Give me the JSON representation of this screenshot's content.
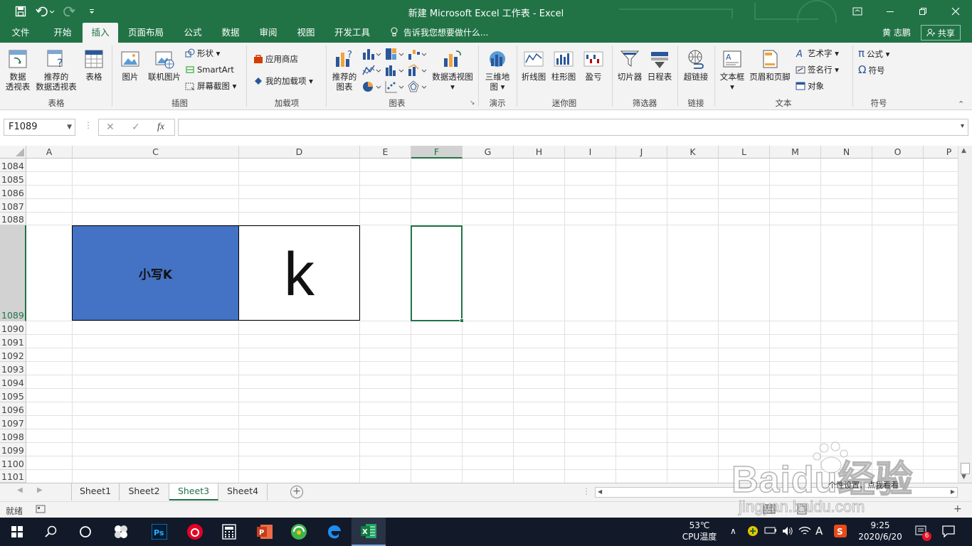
{
  "window": {
    "title": "新建 Microsoft Excel 工作表 - Excel",
    "accent_color": "#217346"
  },
  "quick_access": {
    "save_icon": "save-icon",
    "undo_icon": "undo-icon",
    "redo_icon": "redo-icon",
    "customize_icon": "customize-icon"
  },
  "tabs": [
    {
      "label": "文件"
    },
    {
      "label": "开始"
    },
    {
      "label": "插入",
      "active": true
    },
    {
      "label": "页面布局"
    },
    {
      "label": "公式"
    },
    {
      "label": "数据"
    },
    {
      "label": "审阅"
    },
    {
      "label": "视图"
    },
    {
      "label": "开发工具"
    }
  ],
  "tell_me": "告诉我您想要做什么...",
  "user": "黄 志鹏",
  "share": "共享",
  "ribbon": {
    "tables": {
      "group": "表格",
      "pivot_line1": "数据",
      "pivot_line2": "透视表",
      "rec_pivot_line1": "推荐的",
      "rec_pivot_line2": "数据透视表",
      "table": "表格"
    },
    "illustrations": {
      "group": "插图",
      "pictures": "图片",
      "online_pictures": "联机图片",
      "shapes": "形状",
      "smartart": "SmartArt",
      "screenshot": "屏幕截图"
    },
    "addins": {
      "group": "加载项",
      "store": "应用商店",
      "my_addins": "我的加载项"
    },
    "charts": {
      "group": "图表",
      "rec_line1": "推荐的",
      "rec_line2": "图表",
      "pivotchart": "数据透视图"
    },
    "tours": {
      "group": "演示",
      "map_line1": "三维地",
      "map_line2": "图"
    },
    "sparklines": {
      "group": "迷你图",
      "line": "折线图",
      "column": "柱形图",
      "winloss": "盈亏"
    },
    "filters": {
      "group": "筛选器",
      "slicer": "切片器",
      "timeline": "日程表"
    },
    "links": {
      "group": "链接",
      "hyperlink": "超链接"
    },
    "text": {
      "group": "文本",
      "textbox": "文本框",
      "header_footer": "页眉和页脚",
      "wordart": "艺术字",
      "signature": "签名行",
      "object": "对象"
    },
    "symbols": {
      "group": "符号",
      "equation": "公式",
      "symbol": "符号"
    }
  },
  "formula_bar": {
    "name_box": "F1089",
    "cancel": "✕",
    "enter": "✓",
    "fx": "fx",
    "content": ""
  },
  "columns": [
    "A",
    "C",
    "D",
    "E",
    "F",
    "G",
    "H",
    "I",
    "J",
    "K",
    "L",
    "M",
    "N",
    "O",
    "P"
  ],
  "selected_column": "F",
  "rows": [
    "1084",
    "1085",
    "1086",
    "1087",
    "1088",
    "1089",
    "1090",
    "1091",
    "1092",
    "1093",
    "1094",
    "1095",
    "1096",
    "1097",
    "1098",
    "1099",
    "1100",
    "1101"
  ],
  "selected_row": "1089",
  "cells": {
    "C1089": {
      "value": "小写K",
      "fill": "#4472c4"
    },
    "D1089": {
      "value": "k"
    }
  },
  "sheets": [
    {
      "label": "Sheet1"
    },
    {
      "label": "Sheet2"
    },
    {
      "label": "Sheet3",
      "active": true
    },
    {
      "label": "Sheet4"
    }
  ],
  "status": {
    "ready": "就绪"
  },
  "taskbar": {
    "cpu_temp": "53℃",
    "cpu_label": "CPU温度",
    "time": "9:25",
    "date": "2020/6/20",
    "ime": "A",
    "notification_count": "6"
  },
  "watermark": {
    "brand": "Baidu经验",
    "url": "jingyan.baidu.com",
    "overlay_hint": "个性设置、点我看看"
  }
}
